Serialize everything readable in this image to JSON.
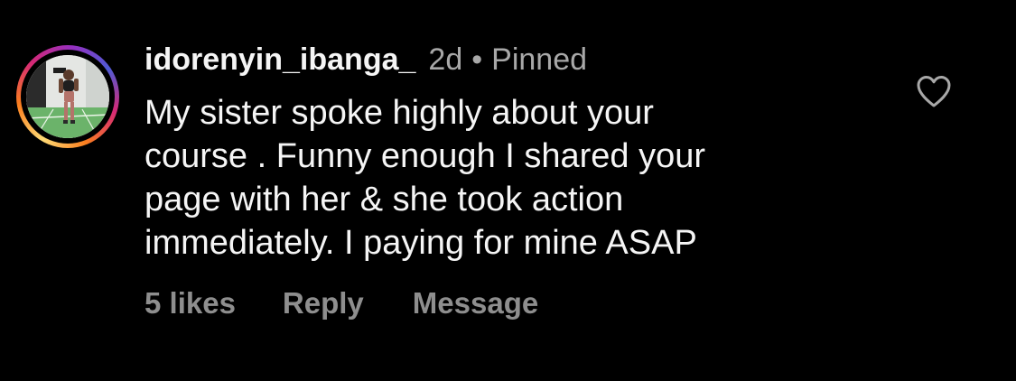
{
  "comment": {
    "username": "idorenyin_ibanga_",
    "time": "2d",
    "separator": "•",
    "status": "Pinned",
    "text_lines": [
      "My sister spoke highly about your",
      "course . Funny enough I shared your",
      "page with her & she took action",
      "immediately. I paying for mine ASAP"
    ],
    "actions": {
      "likes": "5 likes",
      "reply": "Reply",
      "message": "Message"
    }
  },
  "icons": {
    "like": "heart-outline-icon"
  },
  "colors": {
    "background": "#000000",
    "primary_text": "#f5f5f5",
    "secondary_text": "#a8a8a8",
    "action_text": "#8e8e8e",
    "story_ring": [
      "#feda75",
      "#fa7e1e",
      "#d62976",
      "#962fbf",
      "#4f5bd5"
    ]
  }
}
